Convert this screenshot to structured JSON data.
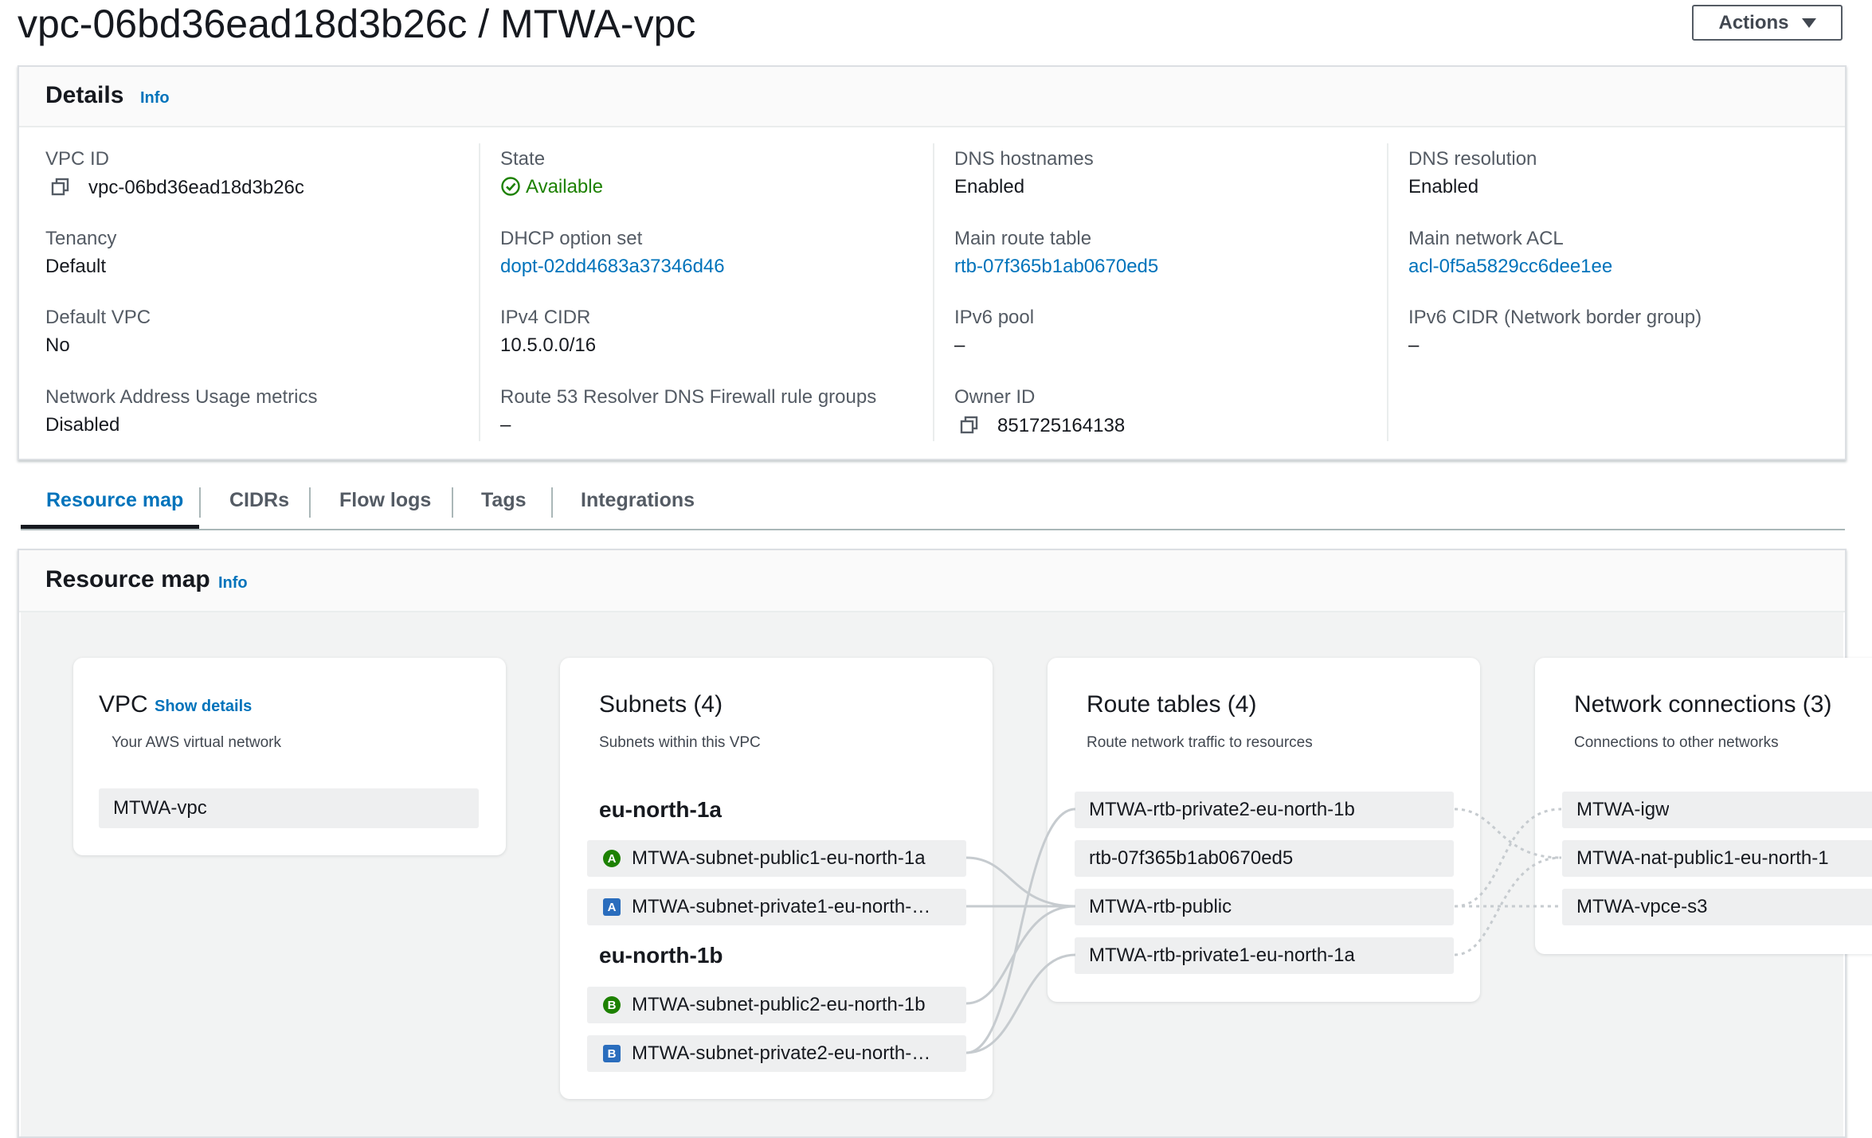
{
  "page": {
    "title": "vpc-06bd36ead18d3b26c / MTWA-vpc",
    "actions_label": "Actions"
  },
  "details": {
    "title": "Details",
    "info": "Info",
    "columns": [
      [
        {
          "label": "VPC ID",
          "value": "vpc-06bd36ead18d3b26c",
          "style": "copy"
        },
        {
          "label": "Tenancy",
          "value": "Default",
          "style": "text"
        },
        {
          "label": "Default VPC",
          "value": "No",
          "style": "text"
        },
        {
          "label": "Network Address Usage metrics",
          "value": "Disabled",
          "style": "text"
        }
      ],
      [
        {
          "label": "State",
          "value": "Available",
          "style": "status"
        },
        {
          "label": "DHCP option set",
          "value": "dopt-02dd4683a37346d46",
          "style": "link"
        },
        {
          "label": "IPv4 CIDR",
          "value": "10.5.0.0/16",
          "style": "text"
        },
        {
          "label": "Route 53 Resolver DNS Firewall rule groups",
          "value": "–",
          "style": "text"
        }
      ],
      [
        {
          "label": "DNS hostnames",
          "value": "Enabled",
          "style": "text"
        },
        {
          "label": "Main route table",
          "value": "rtb-07f365b1ab0670ed5",
          "style": "link"
        },
        {
          "label": "IPv6 pool",
          "value": "–",
          "style": "text"
        },
        {
          "label": "Owner ID",
          "value": "851725164138",
          "style": "copy"
        }
      ],
      [
        {
          "label": "DNS resolution",
          "value": "Enabled",
          "style": "text"
        },
        {
          "label": "Main network ACL",
          "value": "acl-0f5a5829cc6dee1ee",
          "style": "link"
        },
        {
          "label": "IPv6 CIDR (Network border group)",
          "value": "–",
          "style": "text"
        }
      ]
    ]
  },
  "tabs": [
    {
      "label": "Resource map",
      "active": true
    },
    {
      "label": "CIDRs",
      "active": false
    },
    {
      "label": "Flow logs",
      "active": false
    },
    {
      "label": "Tags",
      "active": false
    },
    {
      "label": "Integrations",
      "active": false
    }
  ],
  "resource_map": {
    "title": "Resource map",
    "info": "Info",
    "vpc": {
      "title": "VPC",
      "show_details": "Show details",
      "subtitle": "Your AWS virtual network",
      "item": "MTWA-vpc"
    },
    "subnets": {
      "title": "Subnets (4)",
      "subtitle": "Subnets within this VPC",
      "zones": [
        {
          "name": "eu-north-1a",
          "items": [
            {
              "badge": "A",
              "type": "public",
              "label": "MTWA-subnet-public1-eu-north-1a"
            },
            {
              "badge": "A",
              "type": "private",
              "label": "MTWA-subnet-private1-eu-north-…"
            }
          ]
        },
        {
          "name": "eu-north-1b",
          "items": [
            {
              "badge": "B",
              "type": "public",
              "label": "MTWA-subnet-public2-eu-north-1b"
            },
            {
              "badge": "B",
              "type": "private",
              "label": "MTWA-subnet-private2-eu-north-…"
            }
          ]
        }
      ]
    },
    "route_tables": {
      "title": "Route tables (4)",
      "subtitle": "Route network traffic to resources",
      "items": [
        "MTWA-rtb-private2-eu-north-1b",
        "rtb-07f365b1ab0670ed5",
        "MTWA-rtb-public",
        "MTWA-rtb-private1-eu-north-1a"
      ]
    },
    "network_connections": {
      "title": "Network connections (3)",
      "subtitle": "Connections to other networks",
      "items": [
        "MTWA-igw",
        "MTWA-nat-public1-eu-north-1",
        "MTWA-vpce-s3"
      ]
    }
  },
  "colors": {
    "link": "#0073bb",
    "available": "#1d8102",
    "public_badge": "#1d8102",
    "private_badge": "#2a6dbd"
  }
}
